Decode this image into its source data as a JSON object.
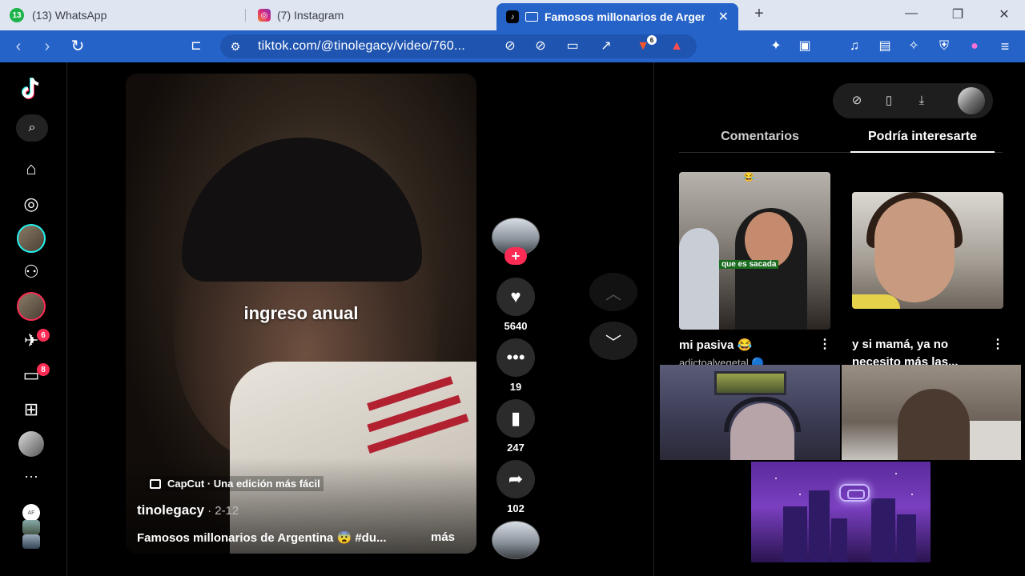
{
  "browser": {
    "tabs": [
      {
        "label": "(13) WhatsApp",
        "badge": "13",
        "active": false
      },
      {
        "label": "(7) Instagram",
        "active": false
      },
      {
        "label": "Famosos millonarios de Argen",
        "active": true
      }
    ],
    "new_tab_label": "+",
    "address": "tiktok.com/@tinolegacy/video/760...",
    "extension_badge": "6"
  },
  "sidebar": {
    "inbox_badge": "6",
    "messages_badge": "8",
    "more_label": "···",
    "mini_avatar_label": "AF"
  },
  "video": {
    "overlay_caption": "ingreso anual",
    "capcut_label": "CapCut · Una edición más fácil",
    "author": "tinolegacy",
    "date": "· 2-12",
    "description": "Famosos millonarios de Argentina 😨 #du...",
    "more_label": "más"
  },
  "actions": {
    "likes": "5640",
    "comments": "19",
    "saves": "247",
    "shares": "102"
  },
  "right_panel": {
    "tab_comments": "Comentarios",
    "tab_interest": "Podría interesarte",
    "cards": [
      {
        "title": "mi pasiva 😂",
        "author": "adictoalvegetal 🔵",
        "thumb_subtitle": "que es sacada"
      },
      {
        "title": "y si mamá, ya no",
        "subtitle": "necesito más las..."
      }
    ]
  },
  "colors": {
    "browser_blue": "#2563c9",
    "tiktok_red": "#fe2c55",
    "background": "#000000"
  }
}
